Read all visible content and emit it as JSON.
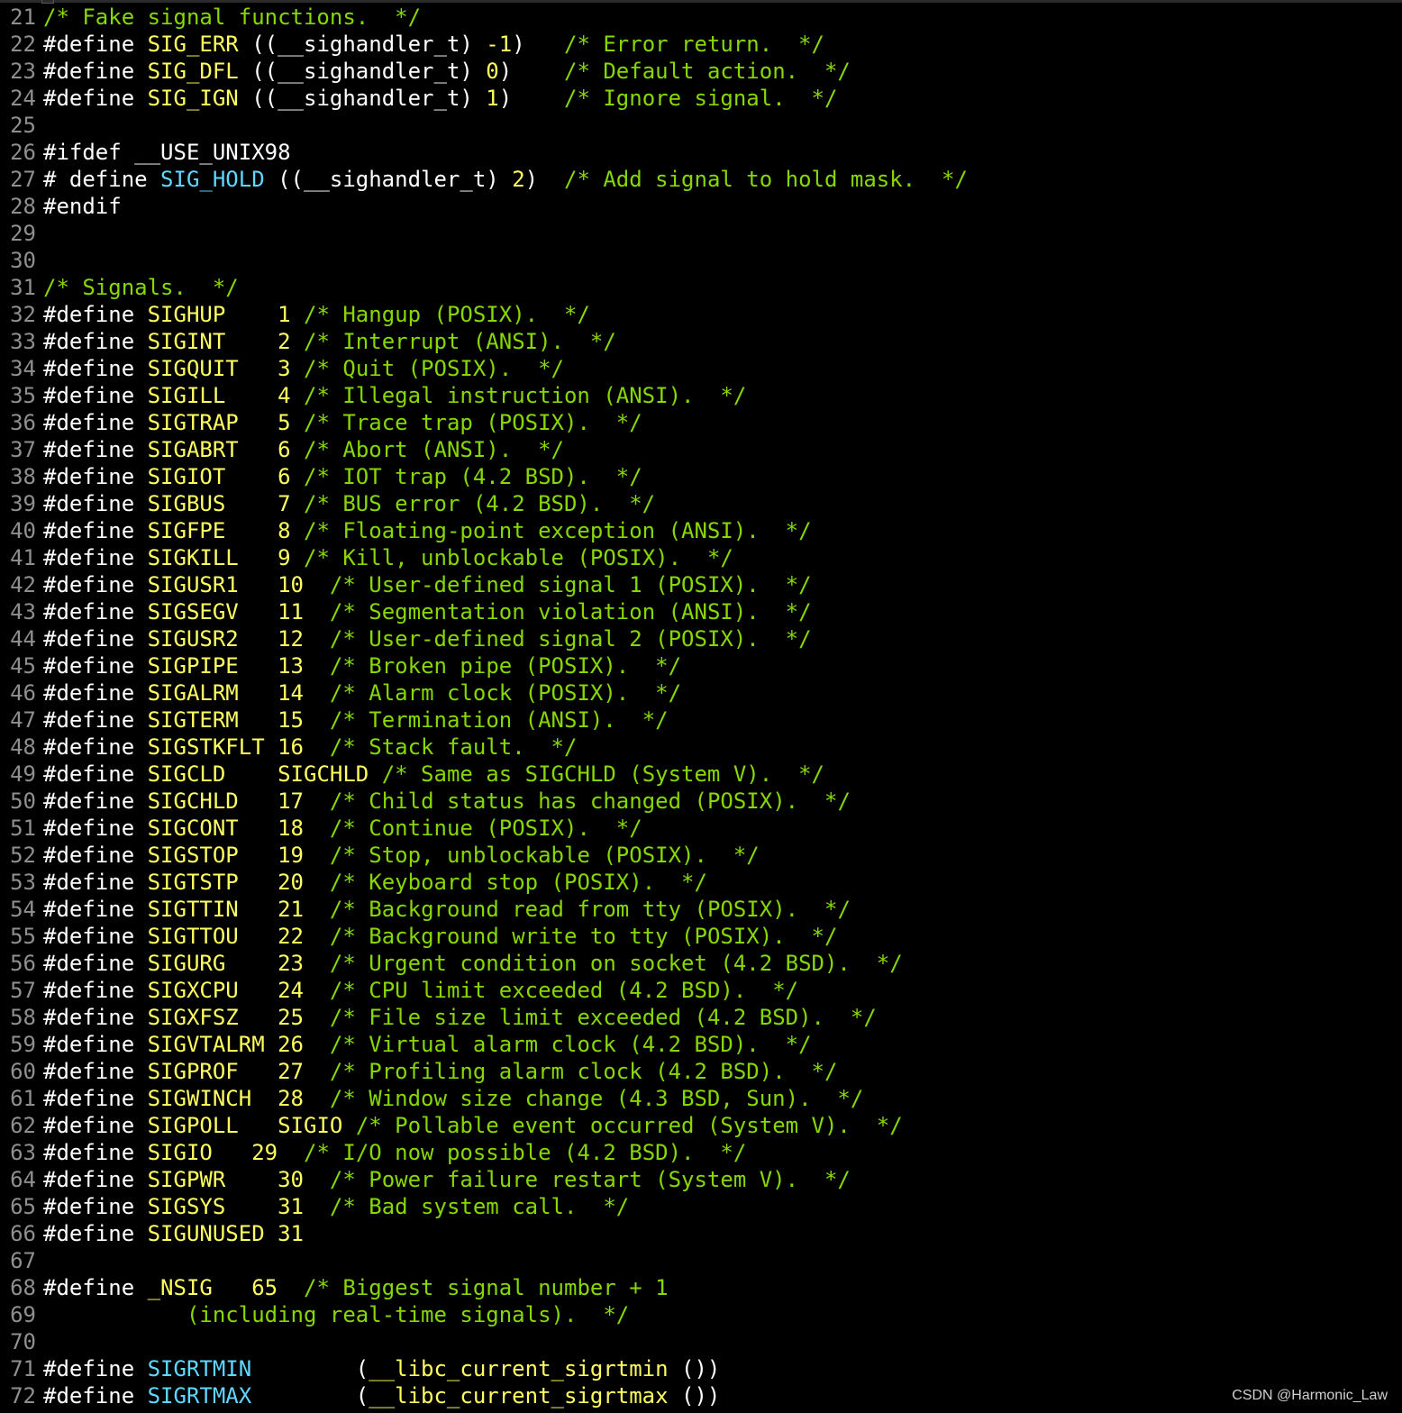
{
  "watermark": "CSDN @Harmonic_Law",
  "colors": {
    "background": "#000000",
    "line_number": "#8f8f8f",
    "text": "#ffffff",
    "macro": "#ffff5f",
    "macro_alt": "#5fd7ff",
    "number": "#ffff5f",
    "comment": "#87d700"
  },
  "lines": [
    {
      "n": "21",
      "tokens": [
        [
          "comment",
          "/* Fake signal functions.  */"
        ]
      ]
    },
    {
      "n": "22",
      "tokens": [
        [
          "preproc",
          "#define "
        ],
        [
          "macro",
          "SIG_ERR"
        ],
        [
          "default",
          " ((__sighandler_t) "
        ],
        [
          "number",
          "-1"
        ],
        [
          "default",
          ")   "
        ],
        [
          "comment",
          "/* Error return.  */"
        ]
      ]
    },
    {
      "n": "23",
      "tokens": [
        [
          "preproc",
          "#define "
        ],
        [
          "macro",
          "SIG_DFL"
        ],
        [
          "default",
          " ((__sighandler_t) "
        ],
        [
          "number",
          "0"
        ],
        [
          "default",
          ")    "
        ],
        [
          "comment",
          "/* Default action.  */"
        ]
      ]
    },
    {
      "n": "24",
      "tokens": [
        [
          "preproc",
          "#define "
        ],
        [
          "macro",
          "SIG_IGN"
        ],
        [
          "default",
          " ((__sighandler_t) "
        ],
        [
          "number",
          "1"
        ],
        [
          "default",
          ")    "
        ],
        [
          "comment",
          "/* Ignore signal.  */"
        ]
      ]
    },
    {
      "n": "25",
      "tokens": []
    },
    {
      "n": "26",
      "tokens": [
        [
          "preproc",
          "#ifdef __USE_UNIX98"
        ]
      ]
    },
    {
      "n": "27",
      "tokens": [
        [
          "preproc",
          "# define "
        ],
        [
          "macro-cyan",
          "SIG_HOLD"
        ],
        [
          "default",
          " ((__sighandler_t) "
        ],
        [
          "number",
          "2"
        ],
        [
          "default",
          ")  "
        ],
        [
          "comment",
          "/* Add signal to hold mask.  */"
        ]
      ]
    },
    {
      "n": "28",
      "tokens": [
        [
          "preproc",
          "#endif"
        ]
      ]
    },
    {
      "n": "29",
      "tokens": []
    },
    {
      "n": "30",
      "tokens": []
    },
    {
      "n": "31",
      "tokens": [
        [
          "comment",
          "/* Signals.  */"
        ]
      ]
    },
    {
      "n": "32",
      "tokens": [
        [
          "preproc",
          "#define "
        ],
        [
          "macro",
          "SIGHUP"
        ],
        [
          "default",
          "    "
        ],
        [
          "number",
          "1"
        ],
        [
          "default",
          " "
        ],
        [
          "comment",
          "/* Hangup (POSIX).  */"
        ]
      ]
    },
    {
      "n": "33",
      "tokens": [
        [
          "preproc",
          "#define "
        ],
        [
          "macro",
          "SIGINT"
        ],
        [
          "default",
          "    "
        ],
        [
          "number",
          "2"
        ],
        [
          "default",
          " "
        ],
        [
          "comment",
          "/* Interrupt (ANSI).  */"
        ]
      ]
    },
    {
      "n": "34",
      "tokens": [
        [
          "preproc",
          "#define "
        ],
        [
          "macro",
          "SIGQUIT"
        ],
        [
          "default",
          "   "
        ],
        [
          "number",
          "3"
        ],
        [
          "default",
          " "
        ],
        [
          "comment",
          "/* Quit (POSIX).  */"
        ]
      ]
    },
    {
      "n": "35",
      "tokens": [
        [
          "preproc",
          "#define "
        ],
        [
          "macro",
          "SIGILL"
        ],
        [
          "default",
          "    "
        ],
        [
          "number",
          "4"
        ],
        [
          "default",
          " "
        ],
        [
          "comment",
          "/* Illegal instruction (ANSI).  */"
        ]
      ]
    },
    {
      "n": "36",
      "tokens": [
        [
          "preproc",
          "#define "
        ],
        [
          "macro",
          "SIGTRAP"
        ],
        [
          "default",
          "   "
        ],
        [
          "number",
          "5"
        ],
        [
          "default",
          " "
        ],
        [
          "comment",
          "/* Trace trap (POSIX).  */"
        ]
      ]
    },
    {
      "n": "37",
      "tokens": [
        [
          "preproc",
          "#define "
        ],
        [
          "macro",
          "SIGABRT"
        ],
        [
          "default",
          "   "
        ],
        [
          "number",
          "6"
        ],
        [
          "default",
          " "
        ],
        [
          "comment",
          "/* Abort (ANSI).  */"
        ]
      ]
    },
    {
      "n": "38",
      "tokens": [
        [
          "preproc",
          "#define "
        ],
        [
          "macro",
          "SIGIOT"
        ],
        [
          "default",
          "    "
        ],
        [
          "number",
          "6"
        ],
        [
          "default",
          " "
        ],
        [
          "comment",
          "/* IOT trap (4.2 BSD).  */"
        ]
      ]
    },
    {
      "n": "39",
      "tokens": [
        [
          "preproc",
          "#define "
        ],
        [
          "macro",
          "SIGBUS"
        ],
        [
          "default",
          "    "
        ],
        [
          "number",
          "7"
        ],
        [
          "default",
          " "
        ],
        [
          "comment",
          "/* BUS error (4.2 BSD).  */"
        ]
      ]
    },
    {
      "n": "40",
      "tokens": [
        [
          "preproc",
          "#define "
        ],
        [
          "macro",
          "SIGFPE"
        ],
        [
          "default",
          "    "
        ],
        [
          "number",
          "8"
        ],
        [
          "default",
          " "
        ],
        [
          "comment",
          "/* Floating-point exception (ANSI).  */"
        ]
      ]
    },
    {
      "n": "41",
      "tokens": [
        [
          "preproc",
          "#define "
        ],
        [
          "macro",
          "SIGKILL"
        ],
        [
          "default",
          "   "
        ],
        [
          "number",
          "9"
        ],
        [
          "default",
          " "
        ],
        [
          "comment",
          "/* Kill, unblockable (POSIX).  */"
        ]
      ]
    },
    {
      "n": "42",
      "tokens": [
        [
          "preproc",
          "#define "
        ],
        [
          "macro",
          "SIGUSR1"
        ],
        [
          "default",
          "   "
        ],
        [
          "number",
          "10"
        ],
        [
          "default",
          "  "
        ],
        [
          "comment",
          "/* User-defined signal 1 (POSIX).  */"
        ]
      ]
    },
    {
      "n": "43",
      "tokens": [
        [
          "preproc",
          "#define "
        ],
        [
          "macro",
          "SIGSEGV"
        ],
        [
          "default",
          "   "
        ],
        [
          "number",
          "11"
        ],
        [
          "default",
          "  "
        ],
        [
          "comment",
          "/* Segmentation violation (ANSI).  */"
        ]
      ]
    },
    {
      "n": "44",
      "tokens": [
        [
          "preproc",
          "#define "
        ],
        [
          "macro",
          "SIGUSR2"
        ],
        [
          "default",
          "   "
        ],
        [
          "number",
          "12"
        ],
        [
          "default",
          "  "
        ],
        [
          "comment",
          "/* User-defined signal 2 (POSIX).  */"
        ]
      ]
    },
    {
      "n": "45",
      "tokens": [
        [
          "preproc",
          "#define "
        ],
        [
          "macro",
          "SIGPIPE"
        ],
        [
          "default",
          "   "
        ],
        [
          "number",
          "13"
        ],
        [
          "default",
          "  "
        ],
        [
          "comment",
          "/* Broken pipe (POSIX).  */"
        ]
      ]
    },
    {
      "n": "46",
      "tokens": [
        [
          "preproc",
          "#define "
        ],
        [
          "macro",
          "SIGALRM"
        ],
        [
          "default",
          "   "
        ],
        [
          "number",
          "14"
        ],
        [
          "default",
          "  "
        ],
        [
          "comment",
          "/* Alarm clock (POSIX).  */"
        ]
      ]
    },
    {
      "n": "47",
      "tokens": [
        [
          "preproc",
          "#define "
        ],
        [
          "macro",
          "SIGTERM"
        ],
        [
          "default",
          "   "
        ],
        [
          "number",
          "15"
        ],
        [
          "default",
          "  "
        ],
        [
          "comment",
          "/* Termination (ANSI).  */"
        ]
      ]
    },
    {
      "n": "48",
      "tokens": [
        [
          "preproc",
          "#define "
        ],
        [
          "macro",
          "SIGSTKFLT"
        ],
        [
          "default",
          " "
        ],
        [
          "number",
          "16"
        ],
        [
          "default",
          "  "
        ],
        [
          "comment",
          "/* Stack fault.  */"
        ]
      ]
    },
    {
      "n": "49",
      "tokens": [
        [
          "preproc",
          "#define "
        ],
        [
          "macro",
          "SIGCLD"
        ],
        [
          "default",
          "    "
        ],
        [
          "macro",
          "SIGCHLD"
        ],
        [
          "default",
          " "
        ],
        [
          "comment",
          "/* Same as SIGCHLD (System V).  */"
        ]
      ]
    },
    {
      "n": "50",
      "tokens": [
        [
          "preproc",
          "#define "
        ],
        [
          "macro",
          "SIGCHLD"
        ],
        [
          "default",
          "   "
        ],
        [
          "number",
          "17"
        ],
        [
          "default",
          "  "
        ],
        [
          "comment",
          "/* Child status has changed (POSIX).  */"
        ]
      ]
    },
    {
      "n": "51",
      "tokens": [
        [
          "preproc",
          "#define "
        ],
        [
          "macro",
          "SIGCONT"
        ],
        [
          "default",
          "   "
        ],
        [
          "number",
          "18"
        ],
        [
          "default",
          "  "
        ],
        [
          "comment",
          "/* Continue (POSIX).  */"
        ]
      ]
    },
    {
      "n": "52",
      "tokens": [
        [
          "preproc",
          "#define "
        ],
        [
          "macro",
          "SIGSTOP"
        ],
        [
          "default",
          "   "
        ],
        [
          "number",
          "19"
        ],
        [
          "default",
          "  "
        ],
        [
          "comment",
          "/* Stop, unblockable (POSIX).  */"
        ]
      ]
    },
    {
      "n": "53",
      "tokens": [
        [
          "preproc",
          "#define "
        ],
        [
          "macro",
          "SIGTSTP"
        ],
        [
          "default",
          "   "
        ],
        [
          "number",
          "20"
        ],
        [
          "default",
          "  "
        ],
        [
          "comment",
          "/* Keyboard stop (POSIX).  */"
        ]
      ]
    },
    {
      "n": "54",
      "tokens": [
        [
          "preproc",
          "#define "
        ],
        [
          "macro",
          "SIGTTIN"
        ],
        [
          "default",
          "   "
        ],
        [
          "number",
          "21"
        ],
        [
          "default",
          "  "
        ],
        [
          "comment",
          "/* Background read from tty (POSIX).  */"
        ]
      ]
    },
    {
      "n": "55",
      "tokens": [
        [
          "preproc",
          "#define "
        ],
        [
          "macro",
          "SIGTTOU"
        ],
        [
          "default",
          "   "
        ],
        [
          "number",
          "22"
        ],
        [
          "default",
          "  "
        ],
        [
          "comment",
          "/* Background write to tty (POSIX).  */"
        ]
      ]
    },
    {
      "n": "56",
      "tokens": [
        [
          "preproc",
          "#define "
        ],
        [
          "macro",
          "SIGURG"
        ],
        [
          "default",
          "    "
        ],
        [
          "number",
          "23"
        ],
        [
          "default",
          "  "
        ],
        [
          "comment",
          "/* Urgent condition on socket (4.2 BSD).  */"
        ]
      ]
    },
    {
      "n": "57",
      "tokens": [
        [
          "preproc",
          "#define "
        ],
        [
          "macro",
          "SIGXCPU"
        ],
        [
          "default",
          "   "
        ],
        [
          "number",
          "24"
        ],
        [
          "default",
          "  "
        ],
        [
          "comment",
          "/* CPU limit exceeded (4.2 BSD).  */"
        ]
      ]
    },
    {
      "n": "58",
      "tokens": [
        [
          "preproc",
          "#define "
        ],
        [
          "macro",
          "SIGXFSZ"
        ],
        [
          "default",
          "   "
        ],
        [
          "number",
          "25"
        ],
        [
          "default",
          "  "
        ],
        [
          "comment",
          "/* File size limit exceeded (4.2 BSD).  */"
        ]
      ]
    },
    {
      "n": "59",
      "tokens": [
        [
          "preproc",
          "#define "
        ],
        [
          "macro",
          "SIGVTALRM"
        ],
        [
          "default",
          " "
        ],
        [
          "number",
          "26"
        ],
        [
          "default",
          "  "
        ],
        [
          "comment",
          "/* Virtual alarm clock (4.2 BSD).  */"
        ]
      ]
    },
    {
      "n": "60",
      "tokens": [
        [
          "preproc",
          "#define "
        ],
        [
          "macro",
          "SIGPROF"
        ],
        [
          "default",
          "   "
        ],
        [
          "number",
          "27"
        ],
        [
          "default",
          "  "
        ],
        [
          "comment",
          "/* Profiling alarm clock (4.2 BSD).  */"
        ]
      ]
    },
    {
      "n": "61",
      "tokens": [
        [
          "preproc",
          "#define "
        ],
        [
          "macro",
          "SIGWINCH"
        ],
        [
          "default",
          "  "
        ],
        [
          "number",
          "28"
        ],
        [
          "default",
          "  "
        ],
        [
          "comment",
          "/* Window size change (4.3 BSD, Sun).  */"
        ]
      ]
    },
    {
      "n": "62",
      "tokens": [
        [
          "preproc",
          "#define "
        ],
        [
          "macro",
          "SIGPOLL"
        ],
        [
          "default",
          "   "
        ],
        [
          "macro",
          "SIGIO"
        ],
        [
          "default",
          " "
        ],
        [
          "comment",
          "/* Pollable event occurred (System V).  */"
        ]
      ]
    },
    {
      "n": "63",
      "tokens": [
        [
          "preproc",
          "#define "
        ],
        [
          "macro",
          "SIGIO"
        ],
        [
          "default",
          "   "
        ],
        [
          "number",
          "29"
        ],
        [
          "default",
          "  "
        ],
        [
          "comment",
          "/* I/O now possible (4.2 BSD).  */"
        ]
      ]
    },
    {
      "n": "64",
      "tokens": [
        [
          "preproc",
          "#define "
        ],
        [
          "macro",
          "SIGPWR"
        ],
        [
          "default",
          "    "
        ],
        [
          "number",
          "30"
        ],
        [
          "default",
          "  "
        ],
        [
          "comment",
          "/* Power failure restart (System V).  */"
        ]
      ]
    },
    {
      "n": "65",
      "tokens": [
        [
          "preproc",
          "#define "
        ],
        [
          "macro",
          "SIGSYS"
        ],
        [
          "default",
          "    "
        ],
        [
          "number",
          "31"
        ],
        [
          "default",
          "  "
        ],
        [
          "comment",
          "/* Bad system call.  */"
        ]
      ]
    },
    {
      "n": "66",
      "tokens": [
        [
          "preproc",
          "#define "
        ],
        [
          "macro",
          "SIGUNUSED"
        ],
        [
          "default",
          " "
        ],
        [
          "number",
          "31"
        ]
      ]
    },
    {
      "n": "67",
      "tokens": []
    },
    {
      "n": "68",
      "tokens": [
        [
          "preproc",
          "#define "
        ],
        [
          "macro",
          "_NSIG"
        ],
        [
          "default",
          "   "
        ],
        [
          "number",
          "65"
        ],
        [
          "default",
          "  "
        ],
        [
          "comment",
          "/* Biggest signal number + 1"
        ]
      ]
    },
    {
      "n": "69",
      "tokens": [
        [
          "default",
          "           "
        ],
        [
          "comment",
          "(including real-time signals).  */"
        ]
      ]
    },
    {
      "n": "70",
      "tokens": []
    },
    {
      "n": "71",
      "tokens": [
        [
          "preproc",
          "#define "
        ],
        [
          "macro-cyan",
          "SIGRTMIN"
        ],
        [
          "default",
          "        "
        ],
        [
          "paren",
          "("
        ],
        [
          "macro",
          "__libc_current_sigrtmin"
        ],
        [
          "paren",
          " ())"
        ]
      ]
    },
    {
      "n": "72",
      "tokens": [
        [
          "preproc",
          "#define "
        ],
        [
          "macro-cyan",
          "SIGRTMAX"
        ],
        [
          "default",
          "        "
        ],
        [
          "paren",
          "("
        ],
        [
          "macro",
          "__libc_current_sigrtmax"
        ],
        [
          "paren",
          " ())"
        ]
      ]
    }
  ]
}
